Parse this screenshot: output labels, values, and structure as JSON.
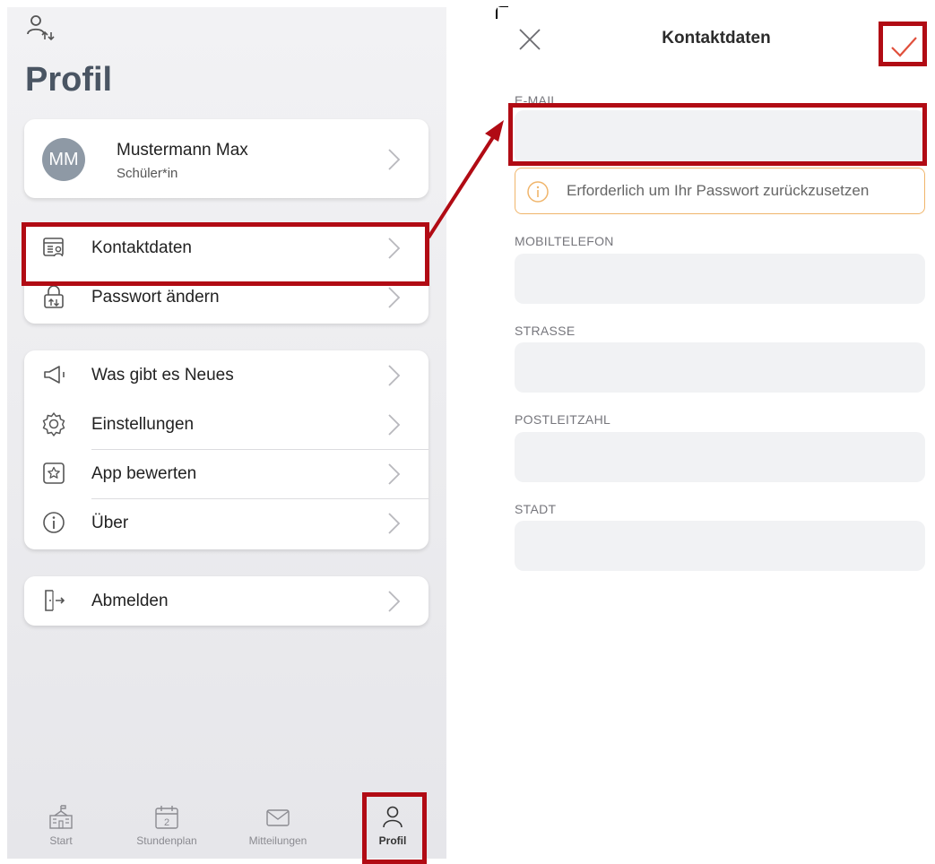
{
  "left": {
    "page_title": "Profil",
    "profile": {
      "initials": "MM",
      "name": "Mustermann Max",
      "role": "Schüler*in"
    },
    "contact_items": [
      {
        "label": "Kontaktdaten",
        "icon": "contact-card-icon"
      },
      {
        "label": "Passwort ändern",
        "icon": "password-lock-icon"
      }
    ],
    "misc_items": [
      {
        "label": "Was gibt es Neues",
        "icon": "megaphone-icon"
      },
      {
        "label": "Einstellungen",
        "icon": "gear-icon"
      },
      {
        "label": "App bewerten",
        "icon": "star-icon"
      },
      {
        "label": "Über",
        "icon": "info-icon"
      }
    ],
    "logout": {
      "label": "Abmelden",
      "icon": "exit-door-icon"
    },
    "tabs": [
      {
        "label": "Start",
        "icon": "school-icon",
        "active": false
      },
      {
        "label": "Stundenplan",
        "icon": "calendar-icon",
        "active": false,
        "calendar_day": "2"
      },
      {
        "label": "Mitteilungen",
        "icon": "envelope-icon",
        "active": false
      },
      {
        "label": "Profil",
        "icon": "person-icon",
        "active": true
      }
    ]
  },
  "right": {
    "title": "Kontaktdaten",
    "fields": {
      "email": {
        "label": "E-MAIL",
        "value": ""
      },
      "mobile": {
        "label": "MOBILTELEFON",
        "value": ""
      },
      "street": {
        "label": "STRASSE",
        "value": ""
      },
      "zip": {
        "label": "POSTLEITZAHL",
        "value": ""
      },
      "city": {
        "label": "STADT",
        "value": ""
      }
    },
    "notice": "Erforderlich um Ihr Passwort zurückzusetzen"
  },
  "colors": {
    "highlight": "#b10b14",
    "confirm_check": "#e0503c",
    "notice_border": "#f0b56b",
    "avatar": "#8e99a5"
  }
}
